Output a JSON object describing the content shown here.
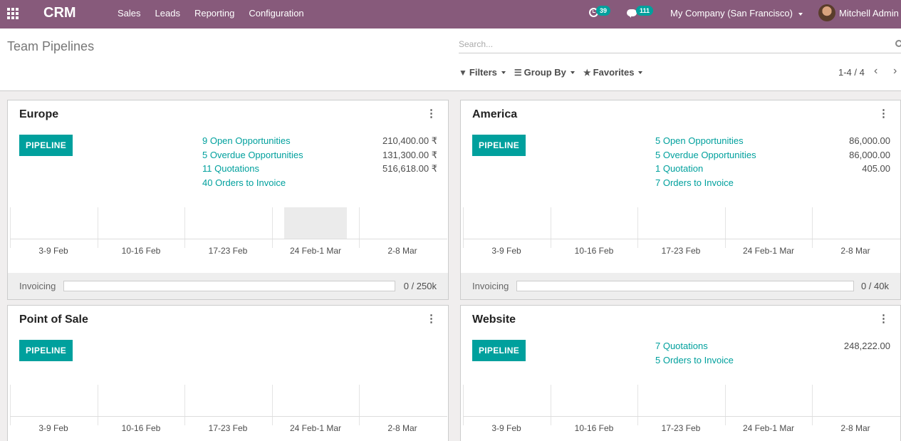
{
  "navbar": {
    "brand": "CRM",
    "menu": [
      "Sales",
      "Leads",
      "Reporting",
      "Configuration"
    ],
    "activity_count": "39",
    "message_count": "111",
    "company": "My Company (San Francisco)",
    "user": "Mitchell Admin"
  },
  "control": {
    "title": "Team Pipelines",
    "search_placeholder": "Search...",
    "filters_label": "Filters",
    "groupby_label": "Group By",
    "favorites_label": "Favorites",
    "pager": "1-4 / 4"
  },
  "pipeline_label": "PIPELINE",
  "invoicing_label": "Invoicing",
  "graph_labels": [
    "3-9 Feb",
    "10-16 Feb",
    "17-23 Feb",
    "24 Feb-1 Mar",
    "2-8 Mar"
  ],
  "cards": [
    {
      "title": "Europe",
      "stats": [
        {
          "label": "9 Open Opportunities",
          "value": "210,400.00 ₹"
        },
        {
          "label": "5 Overdue Opportunities",
          "value": "131,300.00 ₹"
        },
        {
          "label": "11 Quotations",
          "value": "516,618.00 ₹"
        },
        {
          "label": "40 Orders to Invoice",
          "value": ""
        }
      ],
      "invoicing_value": "0 / 250k"
    },
    {
      "title": "America",
      "stats": [
        {
          "label": "5 Open Opportunities",
          "value": "86,000.00"
        },
        {
          "label": "5 Overdue Opportunities",
          "value": "86,000.00"
        },
        {
          "label": "1 Quotation",
          "value": "405.00"
        },
        {
          "label": "7 Orders to Invoice",
          "value": ""
        }
      ],
      "invoicing_value": "0 / 40k"
    },
    {
      "title": "Point of Sale",
      "stats": []
    },
    {
      "title": "Website",
      "stats": [
        {
          "label": "7 Quotations",
          "value": "248,222.00"
        },
        {
          "label": "5 Orders to Invoice",
          "value": ""
        }
      ]
    }
  ]
}
